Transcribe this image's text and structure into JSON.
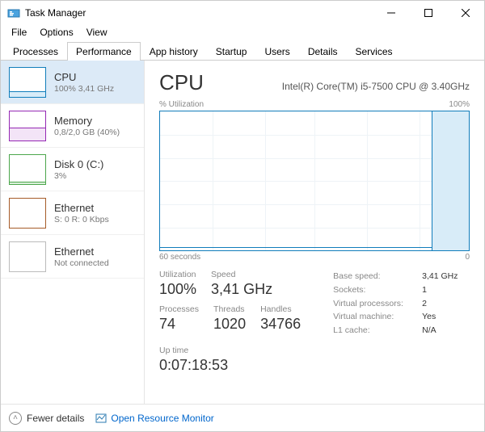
{
  "window": {
    "title": "Task Manager"
  },
  "menu": {
    "file": "File",
    "options": "Options",
    "view": "View"
  },
  "tabs": {
    "processes": "Processes",
    "performance": "Performance",
    "apphistory": "App history",
    "startup": "Startup",
    "users": "Users",
    "details": "Details",
    "services": "Services"
  },
  "sidebar": {
    "items": [
      {
        "name": "CPU",
        "sub": "100% 3,41 GHz"
      },
      {
        "name": "Memory",
        "sub": "0,8/2,0 GB (40%)"
      },
      {
        "name": "Disk 0 (C:)",
        "sub": "3%"
      },
      {
        "name": "Ethernet",
        "sub": "S: 0 R: 0 Kbps"
      },
      {
        "name": "Ethernet",
        "sub": "Not connected"
      }
    ]
  },
  "main": {
    "title": "CPU",
    "subtitle": "Intel(R) Core(TM) i5-7500 CPU @ 3.40GHz",
    "util_label": "% Utilization",
    "util_max": "100%",
    "xaxis_left": "60 seconds",
    "xaxis_right": "0",
    "stats": {
      "utilization_lbl": "Utilization",
      "utilization_val": "100%",
      "speed_lbl": "Speed",
      "speed_val": "3,41 GHz",
      "processes_lbl": "Processes",
      "processes_val": "74",
      "threads_lbl": "Threads",
      "threads_val": "1020",
      "handles_lbl": "Handles",
      "handles_val": "34766",
      "uptime_lbl": "Up time",
      "uptime_val": "0:07:18:53"
    },
    "info": {
      "base_speed_k": "Base speed:",
      "base_speed_v": "3,41 GHz",
      "sockets_k": "Sockets:",
      "sockets_v": "1",
      "vproc_k": "Virtual processors:",
      "vproc_v": "2",
      "vm_k": "Virtual machine:",
      "vm_v": "Yes",
      "l1_k": "L1 cache:",
      "l1_v": "N/A"
    }
  },
  "footer": {
    "fewer": "Fewer details",
    "resmon": "Open Resource Monitor"
  },
  "chart_data": {
    "type": "line",
    "title": "CPU % Utilization",
    "xlabel": "seconds ago",
    "ylabel": "% Utilization",
    "ylim": [
      0,
      100
    ],
    "xlim": [
      60,
      0
    ],
    "x": [
      60,
      8,
      7,
      0
    ],
    "values": [
      2,
      2,
      100,
      100
    ]
  }
}
